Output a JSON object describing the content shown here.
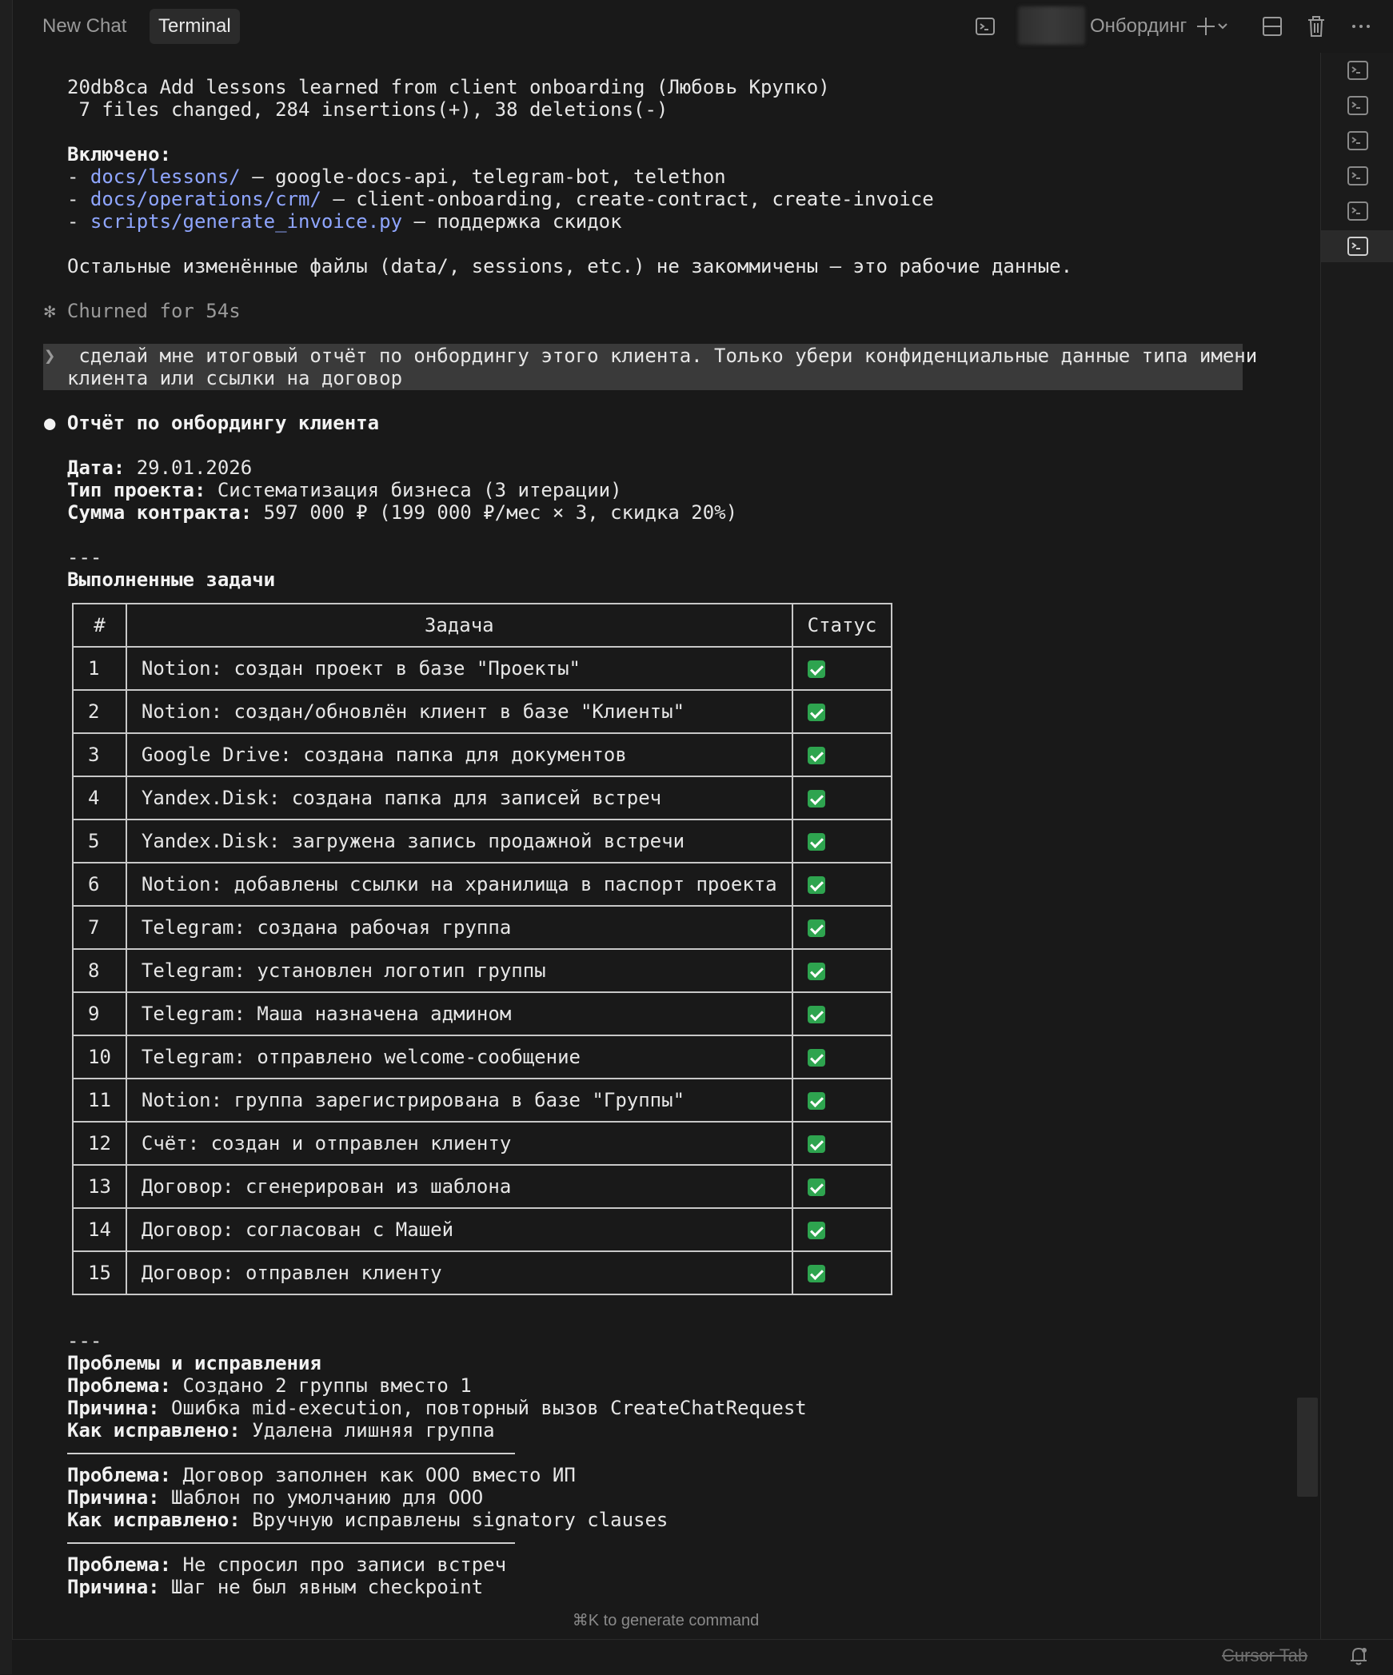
{
  "tabs": [
    {
      "label": "New Chat"
    },
    {
      "label": "Terminal"
    }
  ],
  "header": {
    "title": "Онбординг",
    "icons": [
      "terminal-icon",
      "plus-icon",
      "chevron-down-icon",
      "split-layout-icon",
      "trash-icon",
      "more-icon"
    ]
  },
  "terminal": {
    "commit_line": "20db8ca Add lessons learned from client onboarding (Любовь Крупко)",
    "stats_line": " 7 files changed, 284 insertions(+), 38 deletions(-)",
    "included_label": "Включено:",
    "included": [
      {
        "prefix": "- ",
        "path": "docs/lessons/",
        "desc": " — google-docs-api, telegram-bot, telethon"
      },
      {
        "prefix": "- ",
        "path": "docs/operations/crm/",
        "desc": " — client-onboarding, create-contract, create-invoice"
      },
      {
        "prefix": "- ",
        "path": "scripts/generate_invoice.py",
        "desc": " — поддержка скидок"
      }
    ],
    "rest_line": "Остальные изменённые файлы (data/, sessions, etc.) не закоммичены — это рабочие данные.",
    "churn_star": "✻",
    "churn_text": " Churned for 54s",
    "prompt_marker": "❯",
    "prompt_line1": "  сделай мне итоговый отчёт по онбордингу этого клиента. Только убери конфиденциальные данные типа имени",
    "prompt_line2": "клиента или ссылки на договор",
    "report_bullet": "●",
    "report_title": "Отчёт по онбордингу клиента",
    "meta": [
      {
        "label": "Дата:",
        "value": " 29.01.2026"
      },
      {
        "label": "Тип проекта:",
        "value": " Систематизация бизнеса (3 итерации)"
      },
      {
        "label": "Сумма контракта:",
        "value": " 597 000 ₽ (199 000 ₽/мес × 3, скидка 20%)"
      }
    ],
    "hr1": "---",
    "tasks_title": "Выполненные задачи",
    "table_headers": [
      "#",
      "Задача",
      "Статус"
    ],
    "tasks": [
      {
        "num": "1",
        "task": "Notion: создан проект в базе \"Проекты\"",
        "status": "done"
      },
      {
        "num": "2",
        "task": "Notion: создан/обновлён клиент в базе \"Клиенты\"",
        "status": "done"
      },
      {
        "num": "3",
        "task": "Google Drive: создана папка для документов",
        "status": "done"
      },
      {
        "num": "4",
        "task": "Yandex.Disk: создана папка для записей встреч",
        "status": "done"
      },
      {
        "num": "5",
        "task": "Yandex.Disk: загружена запись продажной встречи",
        "status": "done"
      },
      {
        "num": "6",
        "task": "Notion: добавлены ссылки на хранилища в паспорт проекта",
        "status": "done"
      },
      {
        "num": "7",
        "task": "Telegram: создана рабочая группа",
        "status": "done"
      },
      {
        "num": "8",
        "task": "Telegram: установлен логотип группы",
        "status": "done"
      },
      {
        "num": "9",
        "task": "Telegram: Маша назначена админом",
        "status": "done"
      },
      {
        "num": "10",
        "task": "Telegram: отправлено welcome-сообщение",
        "status": "done"
      },
      {
        "num": "11",
        "task": "Notion: группа зарегистрирована в базе \"Группы\"",
        "status": "done"
      },
      {
        "num": "12",
        "task": "Счёт: создан и отправлен клиенту",
        "status": "done"
      },
      {
        "num": "13",
        "task": "Договор: сгенерирован из шаблона",
        "status": "done"
      },
      {
        "num": "14",
        "task": "Договор: согласован с Машей",
        "status": "done"
      },
      {
        "num": "15",
        "task": "Договор: отправлен клиенту",
        "status": "done"
      }
    ],
    "hr2": "---",
    "issues_title": "Проблемы и исправления",
    "issues": [
      {
        "problem_label": "Проблема:",
        "problem": " Создано 2 группы вместо 1",
        "cause_label": "Причина:",
        "cause": " Ошибка mid-execution, повторный вызов CreateChatRequest",
        "fix_label": "Как исправлено:",
        "fix": " Удалена лишняя группа"
      },
      {
        "problem_label": "Проблема:",
        "problem": " Договор заполнен как ООО вместо ИП",
        "cause_label": "Причина:",
        "cause": " Шаблон по умолчанию для ООО",
        "fix_label": "Как исправлено:",
        "fix": " Вручную исправлены signatory clauses"
      },
      {
        "problem_label": "Проблема:",
        "problem": " Не спросил про записи встреч",
        "cause_label": "Причина:",
        "cause": " Шаг не был явным checkpoint"
      }
    ]
  },
  "footer": {
    "hint": "⌘K to generate command",
    "cursor_tab": "Cursor Tab"
  },
  "right_panel": {
    "items": [
      "terminal-icon",
      "terminal-icon",
      "terminal-icon",
      "terminal-icon",
      "terminal-icon",
      "terminal-icon"
    ],
    "selected_index": 5
  }
}
